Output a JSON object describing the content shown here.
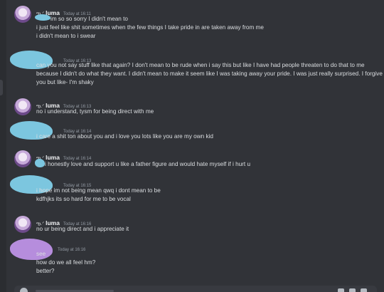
{
  "colors": {
    "background": "#313338",
    "sidebar": "#2b2d31",
    "text": "#dbdee1",
    "timestamp": "#949ba4",
    "redact_blue": "#7cc6df",
    "redact_purple": "#b68ddd"
  },
  "messages": [
    {
      "user_glyph": "ఌ︎.ᐟ",
      "username": "luma",
      "timestamp": "Today at 16:11",
      "lines": [
        "im so so sorry I didn't mean to",
        "i just feel like shit sometimes when the few things I take pride in are taken away from me",
        "i didn't mean to i swear"
      ]
    },
    {
      "timestamp": "Today at 16:13",
      "lines": [
        "can you not say stuff like that again? I don't mean to be rude when i say this but like I have had people threaten to do that to me because I didn't do what they want. I didn't mean to make it seem like I was taking away your pride. I was just really surprised. I forgive you but like- I'm shaky"
      ]
    },
    {
      "user_glyph": "ఌ︎.ᐟ",
      "username": "luma",
      "timestamp": "Today at 16:13",
      "lines": [
        "no i understand, tysm for being direct with me"
      ]
    },
    {
      "timestamp": "Today at 16:14",
      "lines": [
        "i care a shit ton about you and i love you lots like you are my own kid"
      ]
    },
    {
      "user_glyph": "ఌ︎.ᐟ",
      "username": "luma",
      "timestamp": "Today at 16:14",
      "lines": [
        "i honestly love and support u like a father figure and would hate myself if i hurt u"
      ]
    },
    {
      "timestamp": "Today at 16:15",
      "lines": [
        "i hope im not being mean qwq i dont mean to be",
        "kdfhjks its so hard for me to be vocal"
      ]
    },
    {
      "user_glyph": "ఌ︎.ᐟ",
      "username": "luma",
      "timestamp": "Today at 16:16",
      "lines": [
        "no ur being direct and i appreciate it"
      ]
    },
    {
      "timestamp": "Today at 16:16",
      "lines": [
        "see",
        "how do we all feel hm?",
        "better?"
      ]
    }
  ]
}
